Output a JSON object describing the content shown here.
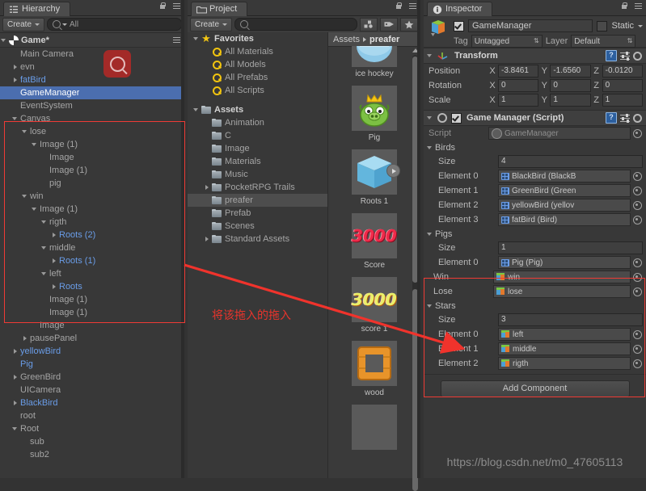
{
  "hierarchy": {
    "tab_label": "Hierarchy",
    "tab_icon": "hierarchy-icon",
    "create_label": "Create",
    "search_value": "All",
    "scene_name": "Game*",
    "items": [
      {
        "label": "Main Camera",
        "depth": 1,
        "arrow": "none",
        "color": "dim"
      },
      {
        "label": "evn",
        "depth": 1,
        "arrow": "right",
        "color": "dim"
      },
      {
        "label": "fatBird",
        "depth": 1,
        "arrow": "right",
        "color": "blue"
      },
      {
        "label": "GameManager",
        "depth": 1,
        "arrow": "none",
        "color": "white",
        "selected": true
      },
      {
        "label": "EventSystem",
        "depth": 1,
        "arrow": "none",
        "color": "dim"
      },
      {
        "label": "Canvas",
        "depth": 1,
        "arrow": "down",
        "color": "dim"
      },
      {
        "label": "lose",
        "depth": 2,
        "arrow": "down",
        "color": "dim"
      },
      {
        "label": "Image (1)",
        "depth": 3,
        "arrow": "down",
        "color": "dim"
      },
      {
        "label": "Image",
        "depth": 4,
        "arrow": "none",
        "color": "dim"
      },
      {
        "label": "Image (1)",
        "depth": 4,
        "arrow": "none",
        "color": "dim"
      },
      {
        "label": "pig",
        "depth": 4,
        "arrow": "none",
        "color": "dim"
      },
      {
        "label": "win",
        "depth": 2,
        "arrow": "down",
        "color": "dim"
      },
      {
        "label": "Image (1)",
        "depth": 3,
        "arrow": "down",
        "color": "dim"
      },
      {
        "label": "rigth",
        "depth": 4,
        "arrow": "down",
        "color": "dim"
      },
      {
        "label": "Roots (2)",
        "depth": 5,
        "arrow": "right",
        "color": "blue"
      },
      {
        "label": "middle",
        "depth": 4,
        "arrow": "down",
        "color": "dim"
      },
      {
        "label": "Roots (1)",
        "depth": 5,
        "arrow": "right",
        "color": "blue"
      },
      {
        "label": "left",
        "depth": 4,
        "arrow": "down",
        "color": "dim"
      },
      {
        "label": "Roots",
        "depth": 5,
        "arrow": "right",
        "color": "blue"
      },
      {
        "label": "Image (1)",
        "depth": 4,
        "arrow": "none",
        "color": "dim"
      },
      {
        "label": "Image (1)",
        "depth": 4,
        "arrow": "none",
        "color": "dim"
      },
      {
        "label": "Image",
        "depth": 3,
        "arrow": "none",
        "color": "dim"
      },
      {
        "label": "pausePanel",
        "depth": 2,
        "arrow": "right",
        "color": "dim"
      },
      {
        "label": "yellowBird",
        "depth": 1,
        "arrow": "right",
        "color": "blue"
      },
      {
        "label": "Pig",
        "depth": 1,
        "arrow": "none",
        "color": "blue"
      },
      {
        "label": "GreenBird",
        "depth": 1,
        "arrow": "right",
        "color": "dim"
      },
      {
        "label": "UICamera",
        "depth": 1,
        "arrow": "none",
        "color": "dim"
      },
      {
        "label": "BlackBird",
        "depth": 1,
        "arrow": "right",
        "color": "blue"
      },
      {
        "label": "root",
        "depth": 1,
        "arrow": "none",
        "color": "dim"
      },
      {
        "label": "Root",
        "depth": 1,
        "arrow": "down",
        "color": "dim"
      },
      {
        "label": "sub",
        "depth": 2,
        "arrow": "none",
        "color": "dim"
      },
      {
        "label": "sub2",
        "depth": 2,
        "arrow": "none",
        "color": "dim"
      }
    ]
  },
  "project": {
    "tab_label": "Project",
    "tab_icon": "folder-icon",
    "create_label": "Create",
    "search_placeholder": "",
    "toolbar_icons": [
      "object-filter-icon",
      "label-filter-icon",
      "favorite-star-icon"
    ],
    "tree": [
      {
        "label": "Favorites",
        "depth": 0,
        "arrow": "down",
        "icon": "star-icon",
        "bold": true
      },
      {
        "label": "All Materials",
        "depth": 1,
        "arrow": "none",
        "icon": "search-icon"
      },
      {
        "label": "All Models",
        "depth": 1,
        "arrow": "none",
        "icon": "search-icon"
      },
      {
        "label": "All Prefabs",
        "depth": 1,
        "arrow": "none",
        "icon": "search-icon"
      },
      {
        "label": "All Scripts",
        "depth": 1,
        "arrow": "none",
        "icon": "search-icon"
      },
      {
        "label": "",
        "depth": 0,
        "arrow": "none",
        "icon": "none",
        "spacer": true
      },
      {
        "label": "Assets",
        "depth": 0,
        "arrow": "down",
        "icon": "folder-icon",
        "bold": true
      },
      {
        "label": "Animation",
        "depth": 1,
        "arrow": "none",
        "icon": "folder-icon"
      },
      {
        "label": "C",
        "depth": 1,
        "arrow": "none",
        "icon": "folder-icon"
      },
      {
        "label": "Image",
        "depth": 1,
        "arrow": "none",
        "icon": "folder-icon"
      },
      {
        "label": "Materials",
        "depth": 1,
        "arrow": "none",
        "icon": "folder-icon"
      },
      {
        "label": "Music",
        "depth": 1,
        "arrow": "none",
        "icon": "folder-icon"
      },
      {
        "label": "PocketRPG Trails",
        "depth": 1,
        "arrow": "right",
        "icon": "folder-icon"
      },
      {
        "label": "preafer",
        "depth": 1,
        "arrow": "none",
        "icon": "folder-icon",
        "selected": true
      },
      {
        "label": "Prefab",
        "depth": 1,
        "arrow": "none",
        "icon": "folder-icon"
      },
      {
        "label": "Scenes",
        "depth": 1,
        "arrow": "none",
        "icon": "folder-icon"
      },
      {
        "label": "Standard Assets",
        "depth": 1,
        "arrow": "right",
        "icon": "folder-icon"
      }
    ],
    "breadcrumb": [
      "Assets",
      "preafer"
    ],
    "assets": [
      {
        "name": "ice hockey",
        "thumb": "ice-hockey"
      },
      {
        "name": "Pig",
        "thumb": "pig"
      },
      {
        "name": "Roots 1",
        "thumb": "cube"
      },
      {
        "name": "Score",
        "thumb": "score-red",
        "thumb_text": "3000"
      },
      {
        "name": "score 1",
        "thumb": "score-yellow",
        "thumb_text": "3000"
      },
      {
        "name": "wood",
        "thumb": "wood"
      },
      {
        "name": "",
        "thumb": "blank"
      }
    ]
  },
  "inspector": {
    "tab_label": "Inspector",
    "tab_icon": "info-icon",
    "object_name": "GameManager",
    "enabled": true,
    "static_label": "Static",
    "static_checked": false,
    "tag_label": "Tag",
    "tag_value": "Untagged",
    "layer_label": "Layer",
    "layer_value": "Default",
    "transform": {
      "title": "Transform",
      "rows": [
        {
          "label": "Position",
          "x": "-3.8461",
          "y": "-1.6560",
          "z": "-0.0120"
        },
        {
          "label": "Rotation",
          "x": "0",
          "y": "0",
          "z": "0"
        },
        {
          "label": "Scale",
          "x": "1",
          "y": "1",
          "z": "1"
        }
      ]
    },
    "script_component": {
      "title": "Game Manager (Script)",
      "enabled": true,
      "script_label": "Script",
      "script_value": "GameManager",
      "groups": [
        {
          "name": "Birds",
          "size_label": "Size",
          "size_value": "4",
          "elements": [
            {
              "label": "Element 0",
              "value": "BlackBird (BlackB",
              "icon": "prefab-icon"
            },
            {
              "label": "Element 1",
              "value": "GreenBird (Green",
              "icon": "prefab-icon"
            },
            {
              "label": "Element 2",
              "value": "yellowBird (yellov",
              "icon": "prefab-icon"
            },
            {
              "label": "Element 3",
              "value": "fatBird (Bird)",
              "icon": "prefab-icon"
            }
          ]
        },
        {
          "name": "Pigs",
          "size_label": "Size",
          "size_value": "1",
          "elements": [
            {
              "label": "Element 0",
              "value": "Pig (Pig)",
              "icon": "prefab-icon"
            }
          ]
        }
      ],
      "single_fields": [
        {
          "label": "Win",
          "value": "win",
          "icon": "gameobject-icon"
        },
        {
          "label": "Lose",
          "value": "lose",
          "icon": "gameobject-icon"
        }
      ],
      "stars_group": {
        "name": "Stars",
        "size_label": "Size",
        "size_value": "3",
        "elements": [
          {
            "label": "Element 0",
            "value": "left",
            "icon": "gameobject-icon"
          },
          {
            "label": "Element 1",
            "value": "middle",
            "icon": "gameobject-icon"
          },
          {
            "label": "Element 2",
            "value": "rigth",
            "icon": "gameobject-icon"
          }
        ]
      }
    },
    "add_component_label": "Add Component",
    "watermark": "https://blog.csdn.net/m0_47605113"
  },
  "annotations": {
    "note_text": "将该拖入的拖入",
    "accent_color": "#ef3b35"
  }
}
